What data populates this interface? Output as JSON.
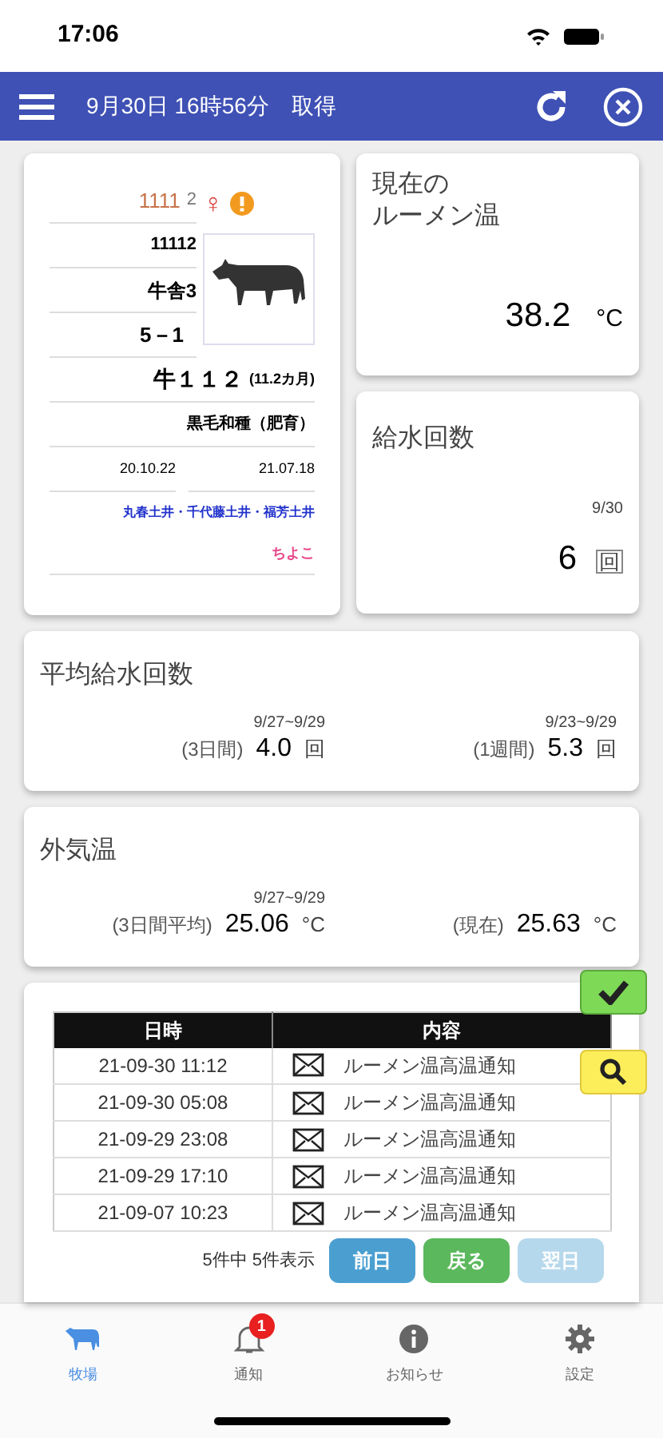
{
  "status_bar": {
    "time": "17:06"
  },
  "header": {
    "title": "9月30日 16時56分　取得"
  },
  "cow_card": {
    "id_main": "1111",
    "id_sub": "2",
    "sex_symbol": "♀",
    "alert": true,
    "tag": "11112",
    "barn": "牛舎3",
    "pen": "5－1",
    "name": "牛１１２",
    "age": "(11.2カ月)",
    "breed": "黒毛和種（肥育）",
    "date_1": "20.10.22",
    "date_2": "21.07.18",
    "lineage": "丸春土井・千代藤土井・福芳土井",
    "owner": "ちよこ"
  },
  "rumen_card": {
    "title_lines": [
      "現在の",
      "ルーメン温"
    ],
    "value": "38.2",
    "unit": "°C"
  },
  "water_card": {
    "title": "給水回数",
    "date": "9/30",
    "value": "6",
    "unit": "回"
  },
  "avg_water_card": {
    "title": "平均給水回数",
    "periods": [
      {
        "range": "9/27~9/29",
        "label": "(3日間)",
        "value": "4.0",
        "unit": "回"
      },
      {
        "range": "9/23~9/29",
        "label": "(1週間)",
        "value": "5.3",
        "unit": "回"
      }
    ]
  },
  "outside_temp_card": {
    "title": "外気温",
    "periods": [
      {
        "range": "9/27~9/29",
        "label": "(3日間平均)",
        "value": "25.06",
        "unit": "°C"
      },
      {
        "label": "(現在)",
        "value": "25.63",
        "unit": "°C"
      }
    ]
  },
  "notifications": {
    "columns": [
      "日時",
      "内容"
    ],
    "rows": [
      {
        "time": "21-09-30 11:12",
        "content": "ルーメン温高温通知"
      },
      {
        "time": "21-09-30 05:08",
        "content": "ルーメン温高温通知"
      },
      {
        "time": "21-09-29 23:08",
        "content": "ルーメン温高温通知"
      },
      {
        "time": "21-09-29 17:10",
        "content": "ルーメン温高温通知"
      },
      {
        "time": "21-09-07 10:23",
        "content": "ルーメン温高温通知"
      }
    ],
    "count": "5件中 5件表示",
    "buttons": [
      {
        "label": "前日",
        "kind": "prev",
        "disabled": false
      },
      {
        "label": "戻る",
        "kind": "back",
        "disabled": false
      },
      {
        "label": "翌日",
        "kind": "next",
        "disabled": true
      }
    ]
  },
  "tab_bar": [
    {
      "label": "牧場",
      "kind": "cow",
      "selected": true
    },
    {
      "label": "通知",
      "kind": "bell",
      "selected": false,
      "badge": "1"
    },
    {
      "label": "お知らせ",
      "kind": "info",
      "selected": false
    },
    {
      "label": "設定",
      "kind": "gear",
      "selected": false
    }
  ]
}
